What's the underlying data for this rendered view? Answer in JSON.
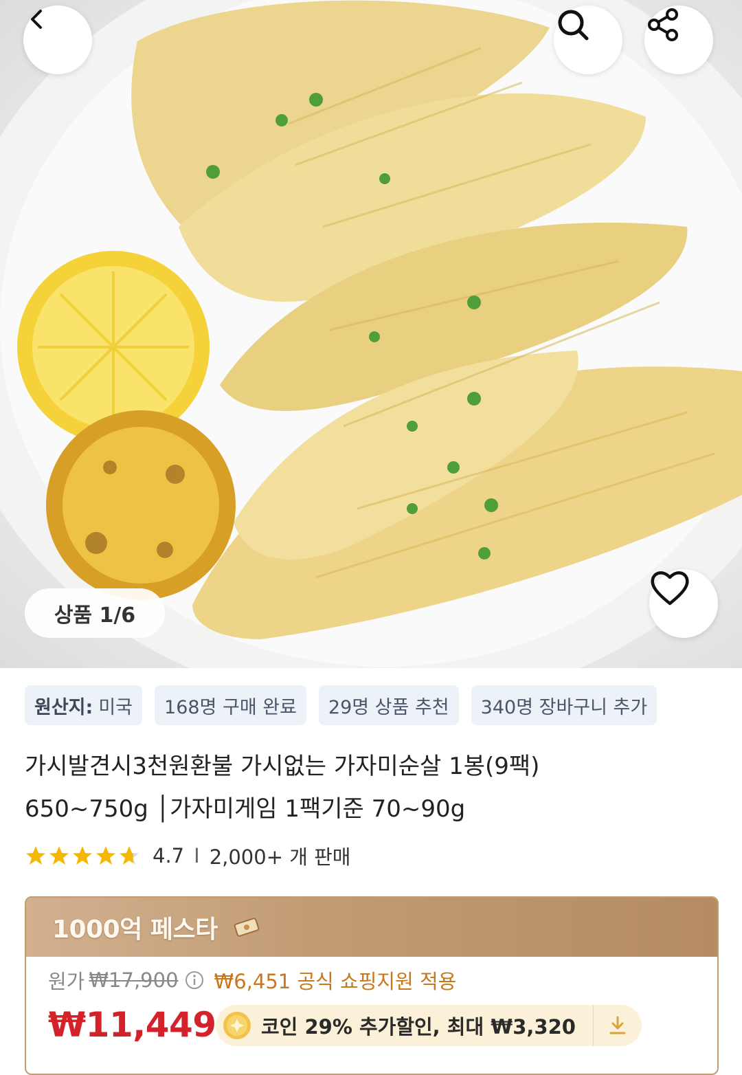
{
  "hero": {
    "counter": "상품 1/6"
  },
  "chips": [
    {
      "label": "원산지:",
      "value": "미국"
    },
    {
      "text": "168명 구매 완료"
    },
    {
      "text": "29명 상품 추천"
    },
    {
      "text": "340명 장바구니 추가"
    }
  ],
  "product": {
    "title_line1": "가시발견시3천원환불 가시없는 가자미순살 1봉(9팩)",
    "title_line2": "650~750g │가자미게임 1팩기준 70~90g",
    "rating_value": "4.7",
    "rating_stars": 4.7,
    "separator": "I",
    "sold": "2,000+ 개 판매"
  },
  "promo": {
    "festival_title": "1000억 페스타",
    "original_label": "원가",
    "original_price": "₩17,900",
    "support_text": "₩6,451 공식 쇼핑지원 적용",
    "price": "₩11,449",
    "coin_text": "코인 29% 추가할인, 최대 ₩3,320"
  },
  "colors": {
    "price_red": "#d4222b",
    "support_orange": "#c8781a",
    "star_yellow": "#f5b800",
    "promo_header": "#c09a72"
  },
  "icons": [
    "back-arrow-icon",
    "search-icon",
    "share-icon",
    "heart-icon",
    "info-icon",
    "coin-icon",
    "download-icon",
    "star-icon"
  ]
}
